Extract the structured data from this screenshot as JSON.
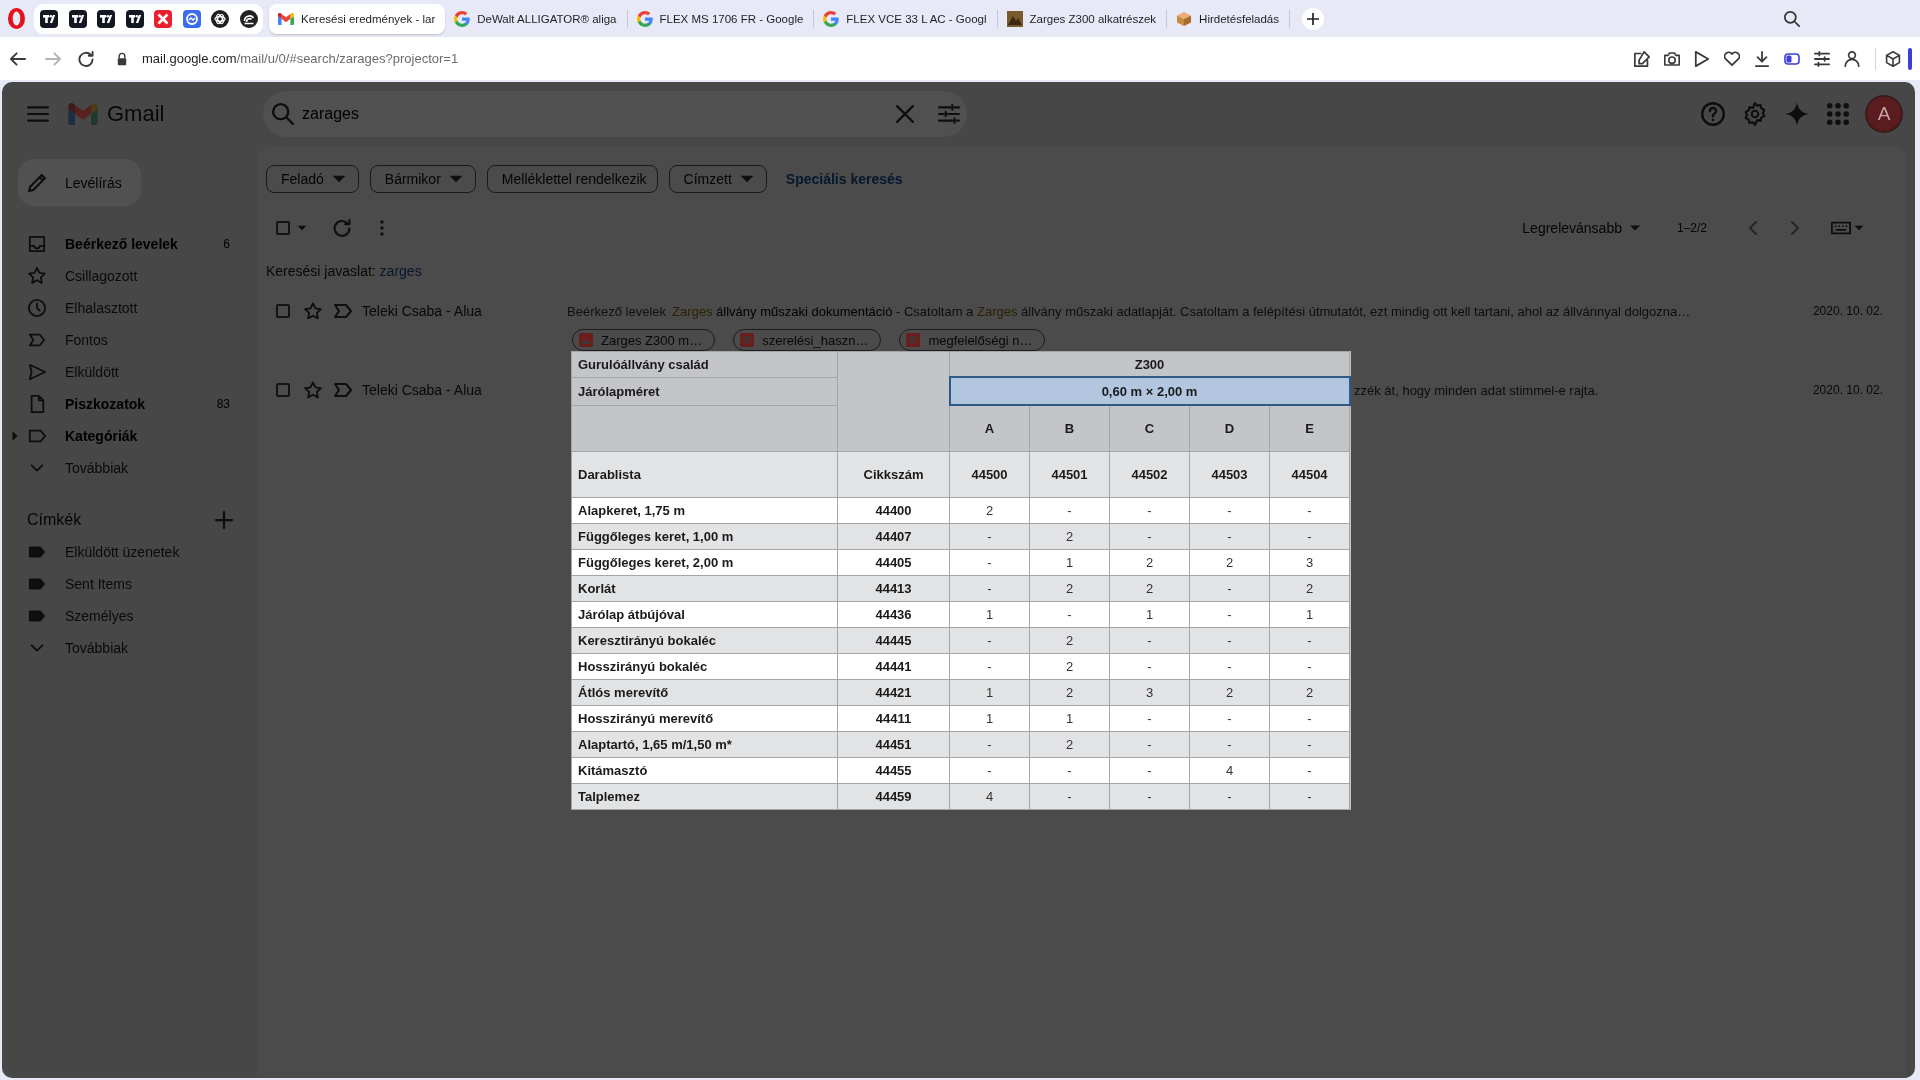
{
  "browser": {
    "tabs": [
      {
        "title": "Keresési eredmények - lar",
        "selected": true
      },
      {
        "title": "DeWalt ALLIGATOR® aliga",
        "selected": false
      },
      {
        "title": "FLEX MS 1706 FR - Google",
        "selected": false
      },
      {
        "title": "FLEX VCE 33 L AC - Googl",
        "selected": false
      },
      {
        "title": "Zarges Z300 alkatrészek",
        "selected": false
      },
      {
        "title": "Hirdetésfeladás",
        "selected": false
      }
    ],
    "address": {
      "host": "mail.google.com",
      "path": "/mail/u/0/#search/zarages?projector=1"
    }
  },
  "gmail": {
    "app_name": "Gmail",
    "search": {
      "value": "zarages"
    },
    "avatar": "A",
    "compose": "Levélírás",
    "nav": [
      {
        "label": "Beérkező levelek",
        "count": "6",
        "unread": true,
        "kind": "folder"
      },
      {
        "label": "Csillagozott",
        "unread": false,
        "kind": "folder"
      },
      {
        "label": "Elhalasztott",
        "unread": false,
        "kind": "folder"
      },
      {
        "label": "Fontos",
        "unread": false,
        "kind": "folder"
      },
      {
        "label": "Elküldött",
        "unread": false,
        "kind": "folder"
      },
      {
        "label": "Piszkozatok",
        "count": "83",
        "unread": true,
        "kind": "folder"
      },
      {
        "label": "Kategóriák",
        "unread": true,
        "kind": "group"
      },
      {
        "label": "Továbbiak",
        "unread": false,
        "kind": "more"
      }
    ],
    "labels_title": "Címkék",
    "labels": [
      {
        "label": "Elküldött üzenetek",
        "kind": "label"
      },
      {
        "label": "Sent Items",
        "kind": "label"
      },
      {
        "label": "Személyes",
        "kind": "label"
      },
      {
        "label": "Továbbiak",
        "kind": "more"
      }
    ],
    "filters": [
      {
        "label": "Feladó",
        "dropdown": true
      },
      {
        "label": "Bármikor",
        "dropdown": true
      },
      {
        "label": "Melléklettel rendelkezik",
        "dropdown": false
      },
      {
        "label": "Címzett",
        "dropdown": true
      }
    ],
    "advanced_search": "Speciális keresés",
    "select_all": {
      "checked": false
    },
    "sort": "Legrelevánsabb",
    "range": "1–2/2",
    "suggestion": {
      "prefix": "Keresési javaslat:",
      "term": "zarges"
    },
    "emails": [
      {
        "sender": "Teleki Csaba - Alua",
        "checked": false,
        "starred": false,
        "important": false,
        "folder": "Beérkező levelek",
        "snippet": [
          {
            "text": "Zarges",
            "kind": "match"
          },
          {
            "text": "állvány műszaki dokumentáció",
            "kind": "subject"
          },
          {
            "text": "- Csatoltam a",
            "kind": "body"
          },
          {
            "text": "Zarges",
            "kind": "match"
          },
          {
            "text": "állvány műszaki adatlapját. Csatoltam a felépítési útmutatót, ezt mindig ott kell tartani, ahol az állvánnyal dolgozna…",
            "kind": "body"
          }
        ],
        "date": "2020. 10. 02.",
        "attachments": [
          {
            "name": "Zarges Z300 m…",
            "kind": "image"
          },
          {
            "name": "szerelési_haszn…",
            "kind": "pdf"
          },
          {
            "name": "megfelelőségi n…",
            "kind": "pdf"
          }
        ]
      },
      {
        "sender": "Teleki Csaba - Alua",
        "checked": false,
        "starred": false,
        "important": false,
        "snippet": [
          {
            "text": "zzék át, hogy minden adat stimmel-e rajta.",
            "kind": "body"
          }
        ],
        "date": "2020. 10. 02."
      }
    ]
  },
  "preview": {
    "table": {
      "family": {
        "label": "Gurulóállvány család",
        "value": "Z300"
      },
      "size": {
        "label": "Járólapméret",
        "value": "0,60 m × 2,00 m",
        "selected": true
      },
      "list_label": "Darablista",
      "number_label": "Cikkszám",
      "variants": [
        {
          "letter": "A",
          "number": "44500"
        },
        {
          "letter": "B",
          "number": "44501"
        },
        {
          "letter": "C",
          "number": "44502"
        },
        {
          "letter": "D",
          "number": "44503"
        },
        {
          "letter": "E",
          "number": "44504"
        }
      ],
      "rows": [
        {
          "name": "Alapkeret, 1,75 m",
          "number": "44400",
          "values": [
            "2",
            "-",
            "-",
            "-",
            "-"
          ]
        },
        {
          "name": "Függőleges keret, 1,00 m",
          "number": "44407",
          "values": [
            "-",
            "2",
            "-",
            "-",
            "-"
          ]
        },
        {
          "name": "Függőleges keret, 2,00 m",
          "number": "44405",
          "values": [
            "-",
            "1",
            "2",
            "2",
            "3"
          ]
        },
        {
          "name": "Korlát",
          "number": "44413",
          "values": [
            "-",
            "2",
            "2",
            "-",
            "2"
          ]
        },
        {
          "name": "Járólap átbújóval",
          "number": "44436",
          "values": [
            "1",
            "-",
            "1",
            "-",
            "1"
          ]
        },
        {
          "name": "Keresztirányú bokaléc",
          "number": "44445",
          "values": [
            "-",
            "2",
            "-",
            "-",
            "-"
          ]
        },
        {
          "name": "Hosszirányú bokaléc",
          "number": "44441",
          "values": [
            "-",
            "2",
            "-",
            "-",
            "-"
          ]
        },
        {
          "name": "Átlós merevítő",
          "number": "44421",
          "values": [
            "1",
            "2",
            "3",
            "2",
            "2"
          ]
        },
        {
          "name": "Hosszirányú merevítő",
          "number": "44411",
          "values": [
            "1",
            "1",
            "-",
            "-",
            "-"
          ]
        },
        {
          "name": "Alaptartó, 1,65 m/1,50 m*",
          "number": "44451",
          "values": [
            "-",
            "2",
            "-",
            "-",
            "-"
          ]
        },
        {
          "name": "Kitámasztó",
          "number": "44455",
          "values": [
            "-",
            "-",
            "-",
            "4",
            "-"
          ]
        },
        {
          "name": "Talplemez",
          "number": "44459",
          "values": [
            "4",
            "-",
            "-",
            "-",
            "-"
          ]
        }
      ]
    }
  }
}
